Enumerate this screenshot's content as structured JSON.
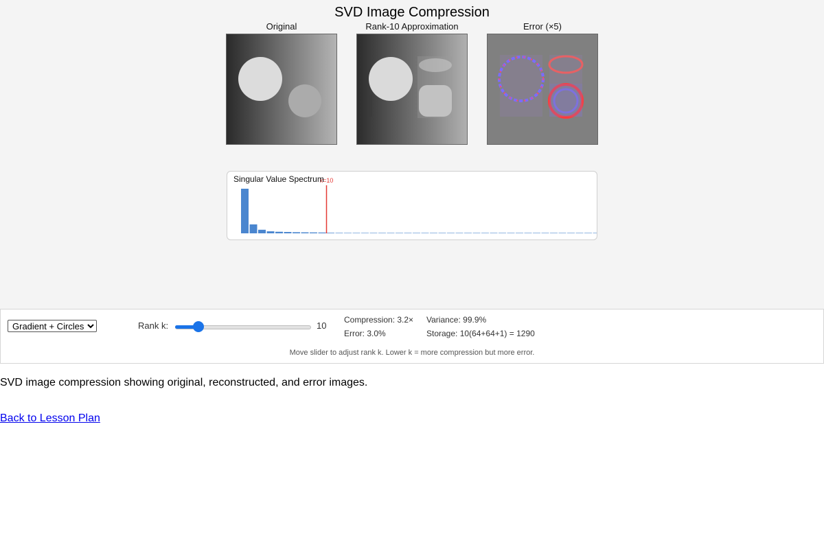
{
  "title": "SVD Image Compression",
  "panels": {
    "original_label": "Original",
    "approx_label": "Rank-10 Approximation",
    "error_label": "Error (×5)"
  },
  "spectrum": {
    "title": "Singular Value Spectrum",
    "marker_label": "k=10",
    "rank_marker": 10,
    "relative_values": [
      1.0,
      0.2,
      0.08,
      0.045,
      0.035,
      0.03,
      0.025,
      0.022,
      0.02,
      0.018,
      0.012,
      0.01,
      0.009,
      0.008,
      0.007,
      0.006,
      0.006,
      0.005,
      0.005,
      0.004,
      0.004,
      0.003,
      0.003,
      0.003,
      0.002,
      0.002,
      0.002,
      0.002,
      0.001,
      0.001,
      0.001,
      0.001,
      0.001,
      0.001,
      0.001,
      0.0005,
      0.0005,
      0.0005,
      0.0005,
      0.0005,
      0.0005,
      0.0005,
      0.0005,
      0.0005,
      0.0005,
      0.0005,
      0.0005,
      0.0005,
      0.0005,
      0.0005,
      0.0005,
      0.0005,
      0.0005,
      0.0005,
      0.0005,
      0.0005,
      0.0005,
      0.0005,
      0.0005,
      0.0005,
      0.0005,
      0.0005,
      0.0005,
      0.0005
    ],
    "bar_color": "#4a86cf",
    "marker_color": "#e53935"
  },
  "controls": {
    "image_select": {
      "selected": "Gradient + Circles"
    },
    "rank_label": "Rank k:",
    "rank_value": "10",
    "slider": {
      "min": 1,
      "max": 64,
      "value": 10
    },
    "compression": "Compression: 3.2×",
    "error": "Error: 3.0%",
    "variance": "Variance: 99.9%",
    "storage": "Storage: 10(64+64+1) = 1290",
    "hint": "Move slider to adjust rank k. Lower k = more compression but more error."
  },
  "caption": "SVD image compression showing original, reconstructed, and error images.",
  "back_link": "Back to Lesson Plan",
  "colors": {
    "accent": "#1a73e8",
    "background": "#f4f4f4",
    "link": "#0000ee"
  }
}
